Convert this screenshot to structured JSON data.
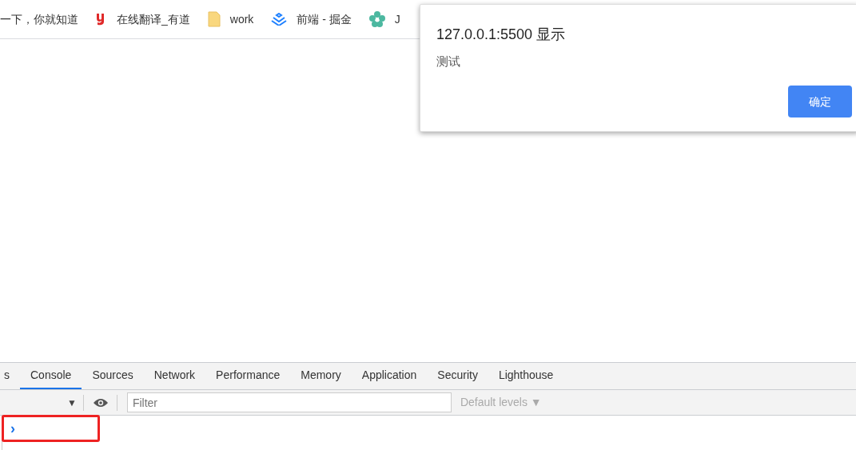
{
  "bookmarks": [
    {
      "kind": "plain",
      "label": "一下，你就知道"
    },
    {
      "kind": "youdao",
      "label": "在线翻译_有道"
    },
    {
      "kind": "folder",
      "label": "work"
    },
    {
      "kind": "juejin",
      "label": "前端 - 掘金"
    },
    {
      "kind": "flower",
      "label": "J"
    }
  ],
  "dialog": {
    "title": "127.0.0.1:5500 显示",
    "message": "测试",
    "button": "确定"
  },
  "devtools": {
    "tabs": [
      {
        "label": "s",
        "selected": false
      },
      {
        "label": "Console",
        "selected": true
      },
      {
        "label": "Sources",
        "selected": false
      },
      {
        "label": "Network",
        "selected": false
      },
      {
        "label": "Performance",
        "selected": false
      },
      {
        "label": "Memory",
        "selected": false
      },
      {
        "label": "Application",
        "selected": false
      },
      {
        "label": "Security",
        "selected": false
      },
      {
        "label": "Lighthouse",
        "selected": false
      }
    ],
    "filter": {
      "placeholder": "Filter"
    },
    "levels": "Default levels ▼",
    "context_caret": "▼",
    "prompt": "›"
  }
}
